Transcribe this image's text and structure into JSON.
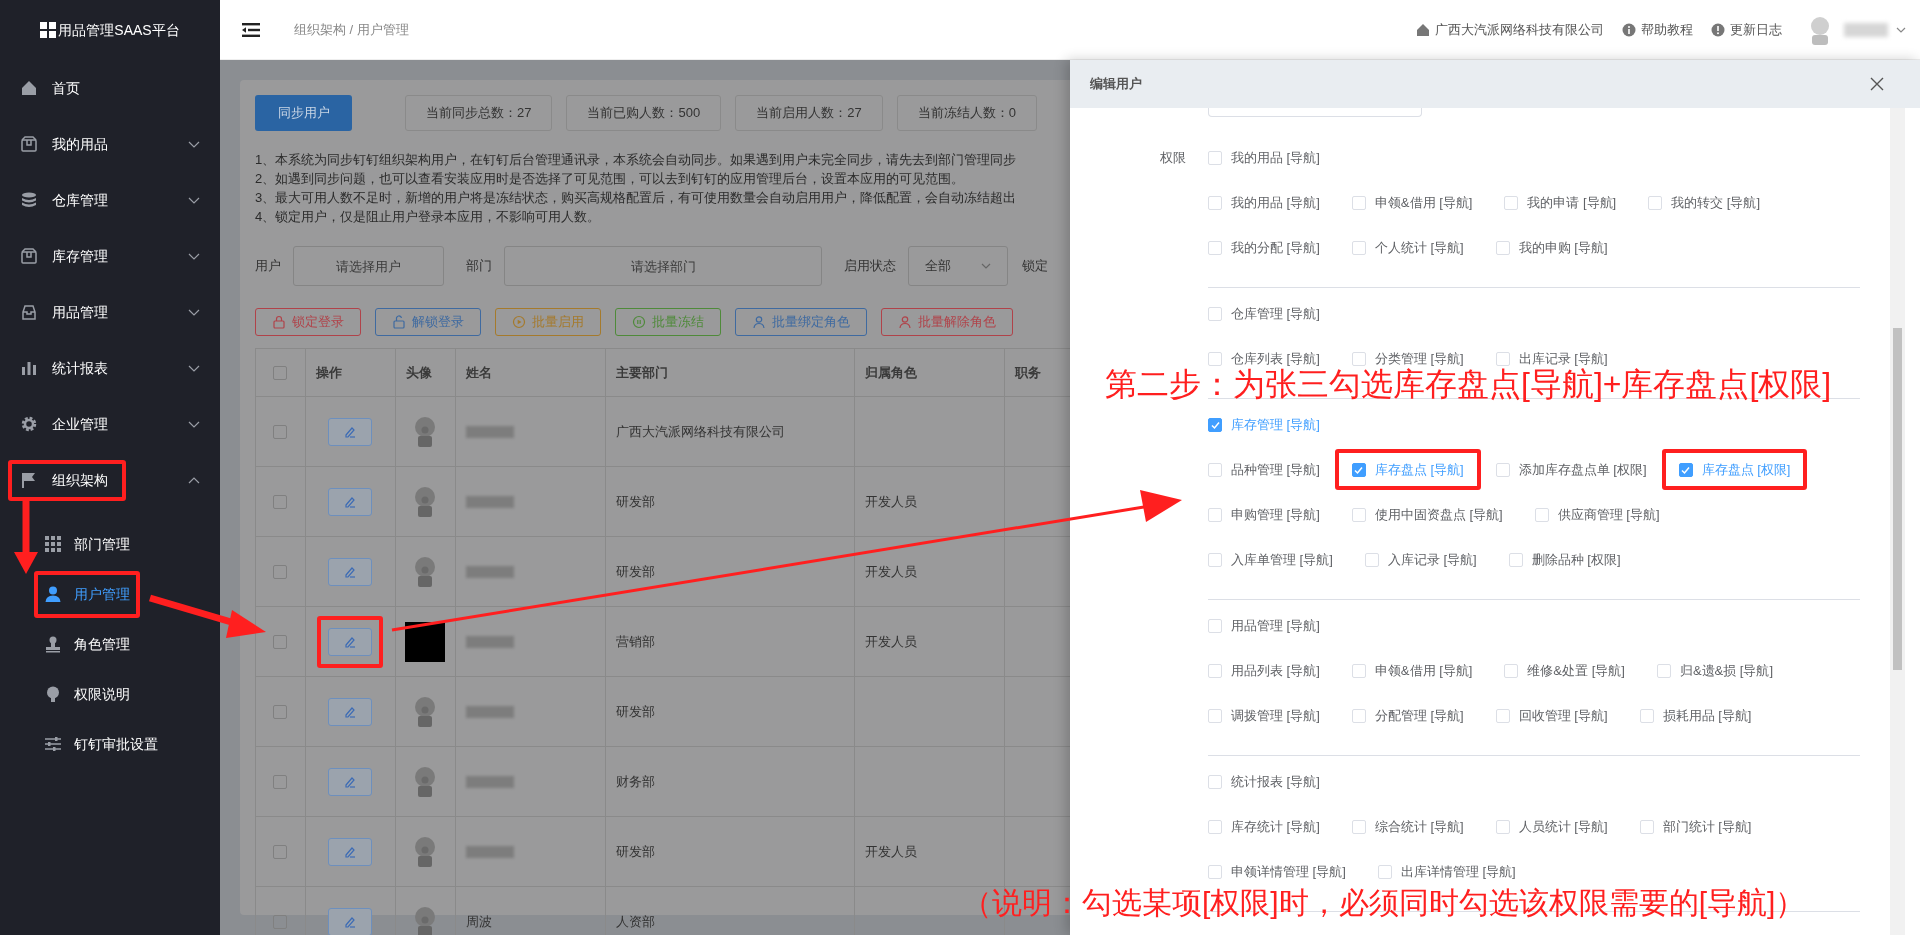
{
  "sidebar": {
    "logo": "用品管理SAAS平台",
    "items": [
      {
        "label": "首页",
        "kind": "link",
        "highlighted": false
      },
      {
        "label": "我的用品",
        "kind": "group",
        "expanded": false,
        "highlighted": false
      },
      {
        "label": "仓库管理",
        "kind": "group",
        "expanded": false,
        "highlighted": false
      },
      {
        "label": "库存管理",
        "kind": "group",
        "expanded": false,
        "highlighted": false
      },
      {
        "label": "用品管理",
        "kind": "group",
        "expanded": false,
        "highlighted": false
      },
      {
        "label": "统计报表",
        "kind": "group",
        "expanded": false,
        "highlighted": false
      },
      {
        "label": "企业管理",
        "kind": "group",
        "expanded": false,
        "highlighted": false
      },
      {
        "label": "组织架构",
        "kind": "group",
        "expanded": true,
        "highlighted": true,
        "children": [
          {
            "label": "部门管理",
            "selected": false,
            "highlighted": false
          },
          {
            "label": "用户管理",
            "selected": true,
            "highlighted": true
          },
          {
            "label": "角色管理",
            "selected": false,
            "highlighted": false
          },
          {
            "label": "权限说明",
            "selected": false,
            "highlighted": false
          },
          {
            "label": "钉钉审批设置",
            "selected": false,
            "highlighted": false
          }
        ]
      }
    ]
  },
  "header": {
    "breadcrumb": "组织架构 / 用户管理",
    "links": [
      "广西大汽派网络科技有限公司",
      "帮助教程",
      "更新日志"
    ]
  },
  "main": {
    "sync_button": "同步用户",
    "stats": [
      "当前同步总数：27",
      "当前已购人数：500",
      "当前启用人数：27",
      "当前冻结人数：0"
    ],
    "notes": [
      "1、本系统为同步钉钉组织架构用户，在钉钉后台管理通讯录，本系统会自动同步。如果遇到用户未完全同步，请先去到部门管理同步",
      "2、如遇到同步问题，也可以查看安装应用时是否选择了可见范围，可以去到钉钉的应用管理后台，设置本应用的可见范围。",
      "3、最大可用人数不足时，新增的用户将是冻结状态，购买高规格配置后，有可使用数量会自动启用用户，降低配置，会自动冻结超出",
      "4、锁定用户，仅是阻止用户登录本应用，不影响可用人数。"
    ],
    "filters": [
      {
        "kind": "input",
        "label": "用户",
        "placeholder": "请选择用户"
      },
      {
        "kind": "input",
        "label": "部门",
        "placeholder": "请选择部门"
      },
      {
        "kind": "select",
        "label": "启用状态",
        "value": "全部"
      },
      {
        "kind": "cut",
        "label": "锁定"
      }
    ],
    "batch_buttons": [
      {
        "label": "锁定登录",
        "color": "#b0434a"
      },
      {
        "label": "解锁登录",
        "color": "#3f6aa0"
      },
      {
        "label": "批量启用",
        "color": "#a57a2c"
      },
      {
        "label": "批量冻结",
        "color": "#4f8a3a"
      },
      {
        "label": "批量绑定角色",
        "color": "#3f6aa0"
      },
      {
        "label": "批量解除角色",
        "color": "#b0434a"
      }
    ],
    "table": {
      "all_checked": false,
      "columns": [
        "操作",
        "头像",
        "姓名",
        "主要部门",
        "归属角色",
        "职务"
      ],
      "rows": [
        {
          "kind": "default",
          "checked": false,
          "department": "广西大汽派网络科技有限公司",
          "highlighted": false
        },
        {
          "kind": "default",
          "checked": false,
          "department": "研发部",
          "role": "开发人员",
          "highlighted": false
        },
        {
          "kind": "default",
          "checked": false,
          "department": "研发部",
          "role": "开发人员",
          "highlighted": false
        },
        {
          "kind": "photo",
          "checked": false,
          "department": "营销部",
          "role": "开发人员",
          "highlighted": true
        },
        {
          "kind": "default",
          "checked": false,
          "department": "研发部",
          "highlighted": false
        },
        {
          "kind": "default",
          "checked": false,
          "department": "财务部",
          "highlighted": false
        },
        {
          "kind": "default",
          "checked": false,
          "department": "研发部",
          "role": "开发人员",
          "highlighted": false
        },
        {
          "kind": "default",
          "checked": false,
          "name": "周波",
          "department": "人资部",
          "highlighted": false
        }
      ]
    }
  },
  "drawer": {
    "title": "编辑用户",
    "permission_label": "权限",
    "sections": [
      {
        "rows": [
          [
            {
              "label": "我的用品 [导航]",
              "checked": false,
              "highlighted": false
            }
          ],
          [
            {
              "label": "我的用品 [导航]",
              "checked": false,
              "highlighted": false
            },
            {
              "label": "申领&借用 [导航]",
              "checked": false,
              "highlighted": false
            },
            {
              "label": "我的申请 [导航]",
              "checked": false,
              "highlighted": false
            },
            {
              "label": "我的转交 [导航]",
              "checked": false,
              "highlighted": false
            }
          ],
          [
            {
              "label": "我的分配 [导航]",
              "checked": false,
              "highlighted": false
            },
            {
              "label": "个人统计 [导航]",
              "checked": false,
              "highlighted": false
            },
            {
              "label": "我的申购 [导航]",
              "checked": false,
              "highlighted": false
            }
          ]
        ]
      },
      {
        "rows": [
          [
            {
              "label": "仓库管理 [导航]",
              "checked": false,
              "highlighted": false
            }
          ],
          [
            {
              "label": "仓库列表 [导航]",
              "checked": false,
              "highlighted": false
            },
            {
              "label": "分类管理 [导航]",
              "checked": false,
              "highlighted": false
            },
            {
              "label": "出库记录 [导航]",
              "checked": false,
              "highlighted": false
            }
          ]
        ]
      },
      {
        "rows": [
          [
            {
              "label": "库存管理 [导航]",
              "checked": true,
              "highlighted": false
            }
          ],
          [
            {
              "label": "品种管理 [导航]",
              "checked": false,
              "highlighted": false
            },
            {
              "label": "库存盘点 [导航]",
              "checked": true,
              "highlighted": true
            },
            {
              "label": "添加库存盘点单 [权限]",
              "checked": false,
              "highlighted": false
            },
            {
              "label": "库存盘点 [权限]",
              "checked": true,
              "highlighted": true
            }
          ],
          [
            {
              "label": "申购管理 [导航]",
              "checked": false,
              "highlighted": false
            },
            {
              "label": "使用中固资盘点 [导航]",
              "checked": false,
              "highlighted": false
            },
            {
              "label": "供应商管理 [导航]",
              "checked": false,
              "highlighted": false
            }
          ],
          [
            {
              "label": "入库单管理 [导航]",
              "checked": false,
              "highlighted": false
            },
            {
              "label": "入库记录 [导航]",
              "checked": false,
              "highlighted": false
            },
            {
              "label": "删除品种 [权限]",
              "checked": false,
              "highlighted": false
            }
          ]
        ]
      },
      {
        "rows": [
          [
            {
              "label": "用品管理 [导航]",
              "checked": false,
              "highlighted": false
            }
          ],
          [
            {
              "label": "用品列表 [导航]",
              "checked": false,
              "highlighted": false
            },
            {
              "label": "申领&借用 [导航]",
              "checked": false,
              "highlighted": false
            },
            {
              "label": "维修&处置 [导航]",
              "checked": false,
              "highlighted": false
            },
            {
              "label": "归&遗&损 [导航]",
              "checked": false,
              "highlighted": false
            }
          ],
          [
            {
              "label": "调拨管理 [导航]",
              "checked": false,
              "highlighted": false
            },
            {
              "label": "分配管理 [导航]",
              "checked": false,
              "highlighted": false
            },
            {
              "label": "回收管理 [导航]",
              "checked": false,
              "highlighted": false
            },
            {
              "label": "损耗用品 [导航]",
              "checked": false,
              "highlighted": false
            }
          ]
        ]
      },
      {
        "rows": [
          [
            {
              "label": "统计报表 [导航]",
              "checked": false,
              "highlighted": false
            }
          ],
          [
            {
              "label": "库存统计 [导航]",
              "checked": false,
              "highlighted": false
            },
            {
              "label": "综合统计 [导航]",
              "checked": false,
              "highlighted": false
            },
            {
              "label": "人员统计 [导航]",
              "checked": false,
              "highlighted": false
            },
            {
              "label": "部门统计 [导航]",
              "checked": false,
              "highlighted": false
            }
          ],
          [
            {
              "label": "申领详情管理 [导航]",
              "checked": false,
              "highlighted": false
            },
            {
              "label": "出库详情管理 [导航]",
              "checked": false,
              "highlighted": false
            }
          ]
        ]
      }
    ]
  },
  "annotations": {
    "step": "第二步：为张三勾选库存盘点[导航]+库存盘点[权限]",
    "note": "（说明：勾选某项[权限]时，必须同时勾选该权限需要的[导航]）"
  }
}
